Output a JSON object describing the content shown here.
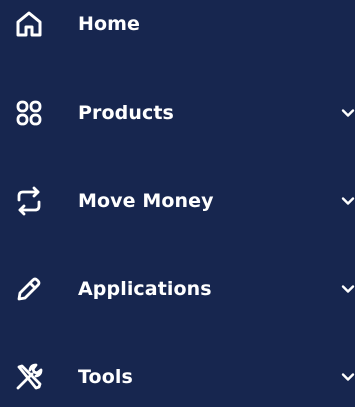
{
  "nav": {
    "items": [
      {
        "label": "Home",
        "icon": "home-icon",
        "has_chevron": false
      },
      {
        "label": "Products",
        "icon": "products-grid-icon",
        "has_chevron": true
      },
      {
        "label": "Move Money",
        "icon": "transfer-arrows-icon",
        "has_chevron": true
      },
      {
        "label": "Applications",
        "icon": "pencil-icon",
        "has_chevron": true
      },
      {
        "label": "Tools",
        "icon": "tools-icon",
        "has_chevron": true
      }
    ]
  },
  "colors": {
    "background": "#17264f",
    "foreground": "#ffffff"
  }
}
